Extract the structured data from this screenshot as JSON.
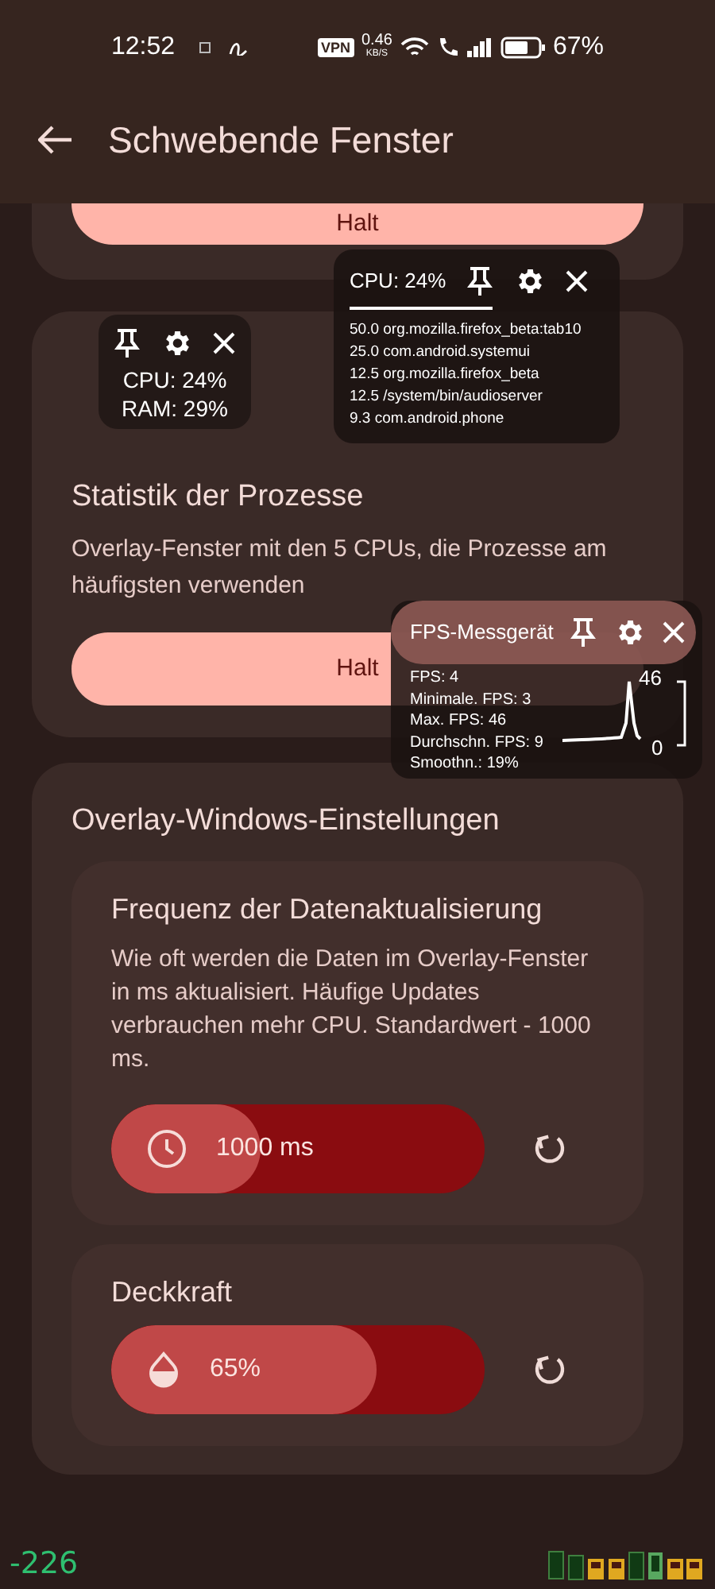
{
  "status_bar": {
    "time": "12:52",
    "vpn": "VPN",
    "speed_value": "0.46",
    "speed_unit": "KB/S",
    "battery": "67%"
  },
  "app_bar": {
    "title": "Schwebende Fenster"
  },
  "sections": [
    {
      "kind": "button_only",
      "button": "Halt"
    },
    {
      "kind": "process_stats",
      "title": "Statistik der Prozesse",
      "description": "Overlay-Fenster mit den 5 CPUs, die Prozesse am häufigsten verwenden",
      "button": "Halt"
    },
    {
      "kind": "settings",
      "title": "Overlay-Windows-Einstellungen",
      "items": [
        {
          "title": "Frequenz der Datenaktualisierung",
          "description": "Wie oft werden die Daten im Overlay-Fenster in ms aktualisiert. Häufige Updates verbrauchen mehr CPU. Standardwert - 1000 ms.",
          "value": "1000 ms",
          "level": 0.4
        },
        {
          "title": "Deckkraft",
          "value": "65%",
          "level": 0.71
        }
      ]
    }
  ],
  "overlays": {
    "mini": {
      "cpu": "CPU: 24%",
      "ram": "RAM: 29%"
    },
    "cpu": {
      "title": "CPU: 24%",
      "processes": [
        "50.0 org.mozilla.firefox_beta:tab10",
        "25.0 com.android.systemui",
        "12.5 org.mozilla.firefox_beta",
        "12.5 /system/bin/audioserver",
        "9.3 com.android.phone"
      ]
    },
    "fps": {
      "title": "FPS-Messgerät",
      "stats": [
        "FPS: 4",
        "Minimale. FPS: 3",
        "Max. FPS: 46",
        "Durchschn. FPS: 9",
        "Smoothn.: 19%"
      ],
      "max_label": "46",
      "min_label": "0"
    }
  },
  "debug": {
    "counter": "-226"
  }
}
